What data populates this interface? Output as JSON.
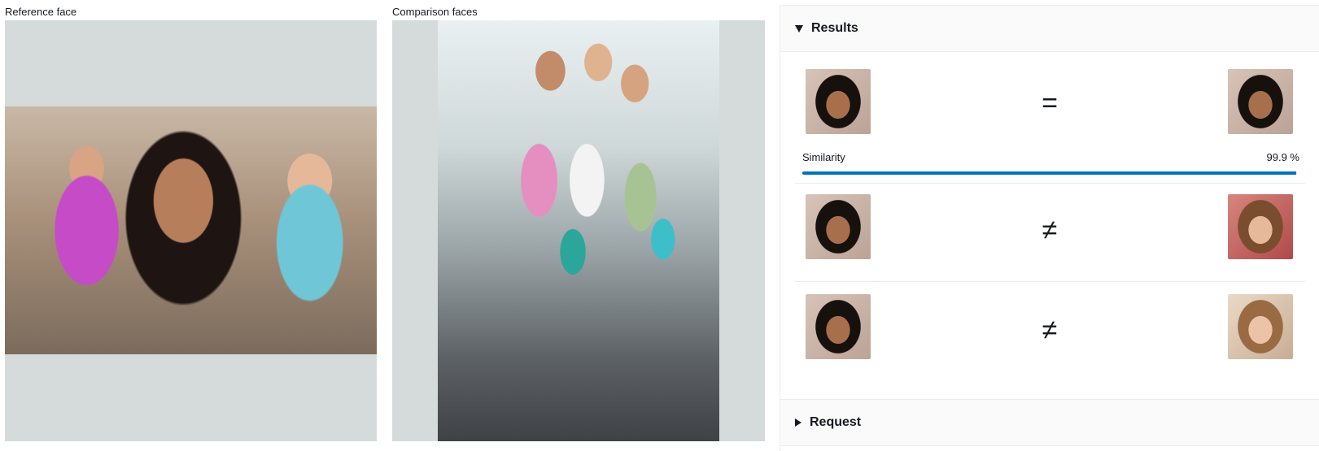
{
  "reference": {
    "label": "Reference face"
  },
  "comparison": {
    "label": "Comparison faces"
  },
  "results": {
    "title": "Results",
    "rows": [
      {
        "symbol": "=",
        "similarity_label": "Similarity",
        "similarity_value": "99.9 %",
        "similarity_fraction": 0.999
      },
      {
        "symbol": "≠"
      },
      {
        "symbol": "≠"
      }
    ]
  },
  "request": {
    "title": "Request"
  },
  "colors": {
    "accent": "#0073bb",
    "panel_bg": "#d5dbdb",
    "header_bg": "#fafafa"
  }
}
